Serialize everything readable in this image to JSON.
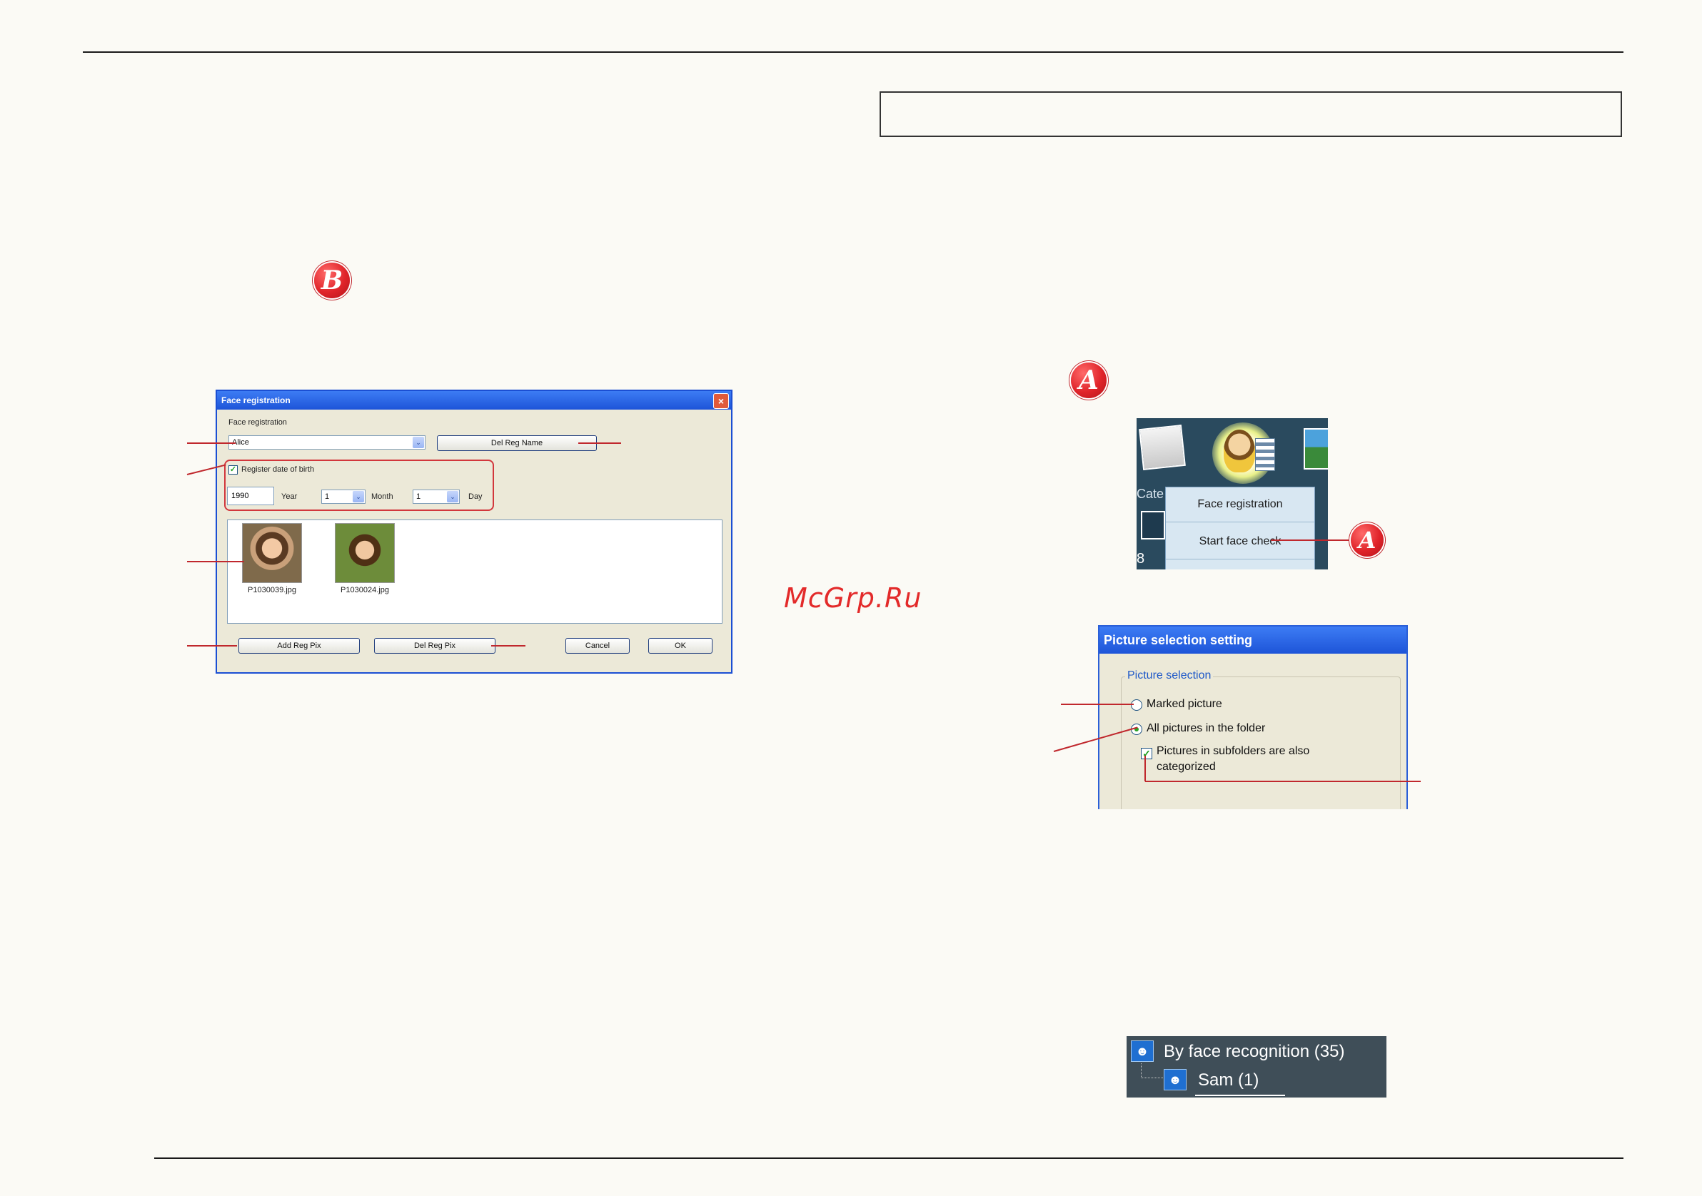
{
  "markers": {
    "b": "B",
    "a": "A",
    "a_menu": "A"
  },
  "watermark": "McGrp.Ru",
  "face_dialog": {
    "title": "Face registration",
    "close": "×",
    "section_label": "Face registration",
    "name_value": "Alice",
    "combo_arrow": "⌄",
    "del_reg_name": "Del Reg Name",
    "register_dob_label": "Register date of birth",
    "register_dob_checked": true,
    "year_value": "1990",
    "year_label": "Year",
    "month_value": "1",
    "month_label": "Month",
    "day_value": "1",
    "day_label": "Day",
    "photos": [
      {
        "file": "P1030039.jpg"
      },
      {
        "file": "P1030024.jpg"
      }
    ],
    "add_reg_pix": "Add Reg Pix",
    "del_reg_pix": "Del Reg Pix",
    "cancel": "Cancel",
    "ok": "OK"
  },
  "app_menu": {
    "partial_label": "Cate",
    "count_fragment": "8",
    "items": [
      "Face registration",
      "Start face check"
    ]
  },
  "picture_selection": {
    "title": "Picture selection setting",
    "group_caption": "Picture selection",
    "option_marked": "Marked picture",
    "option_all": "All pictures in the folder",
    "selected": "All pictures in the folder",
    "subfolders_line1": "Pictures in subfolders are also",
    "subfolders_line2": "categorized",
    "subfolders_checked": true
  },
  "tree": {
    "root_label": "By face recognition  (35)",
    "child_label": "Sam (1)"
  }
}
